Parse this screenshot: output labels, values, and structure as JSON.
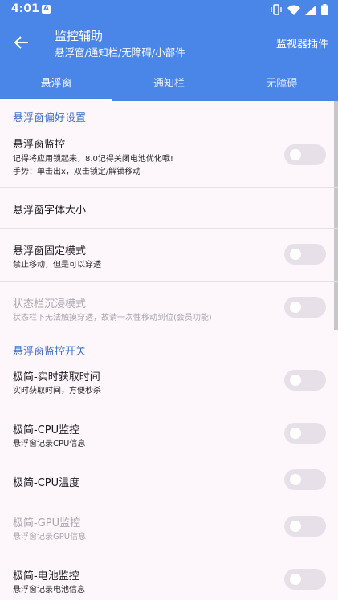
{
  "status_bar": {
    "time": "4:01",
    "notification_icon": "A",
    "icons": [
      "vibrate-icon",
      "wifi-icon",
      "signal-icon",
      "battery-icon"
    ]
  },
  "app_bar": {
    "title": "监控辅助",
    "subtitle": "悬浮窗/通知栏/无障碍/小部件",
    "action_label": "监视器插件",
    "back_icon": "arrow-back-icon"
  },
  "tabs": [
    {
      "label": "悬浮窗",
      "active": true
    },
    {
      "label": "通知栏",
      "active": false
    },
    {
      "label": "无障碍",
      "active": false
    }
  ],
  "sections": {
    "preferences": "悬浮窗偏好设置",
    "monitor_switches": "悬浮窗监控开关"
  },
  "items": {
    "float_monitor": {
      "title": "悬浮窗监控",
      "line1": "记得将应用锁起来，8.0记得关闭电池优化哦!",
      "line2": "手势：单击出x，双击锁定/解锁移动"
    },
    "font_size": {
      "title": "悬浮窗字体大小"
    },
    "fixed_mode": {
      "title": "悬浮窗固定模式",
      "sub": "禁止移动，但是可以穿透"
    },
    "immersive": {
      "title": "状态栏沉浸模式",
      "sub": "状态栏下无法触摸穿透，故请一次性移动到位(会员功能)"
    },
    "realtime": {
      "title": "极简-实时获取时间",
      "sub": "实时获取时间，方便秒杀"
    },
    "cpu": {
      "title": "极简-CPU监控",
      "sub": "悬浮窗记录CPU信息"
    },
    "cpu_temp": {
      "title": "极简-CPU温度"
    },
    "gpu": {
      "title": "极简-GPU监控",
      "sub": "悬浮窗记录GPU信息"
    },
    "battery": {
      "title": "极简-电池监控",
      "sub": "悬浮窗记录电池信息"
    }
  },
  "colors": {
    "primary": "#4a86e8",
    "section_header": "#3f6fc9",
    "background": "#fdf7fc"
  }
}
